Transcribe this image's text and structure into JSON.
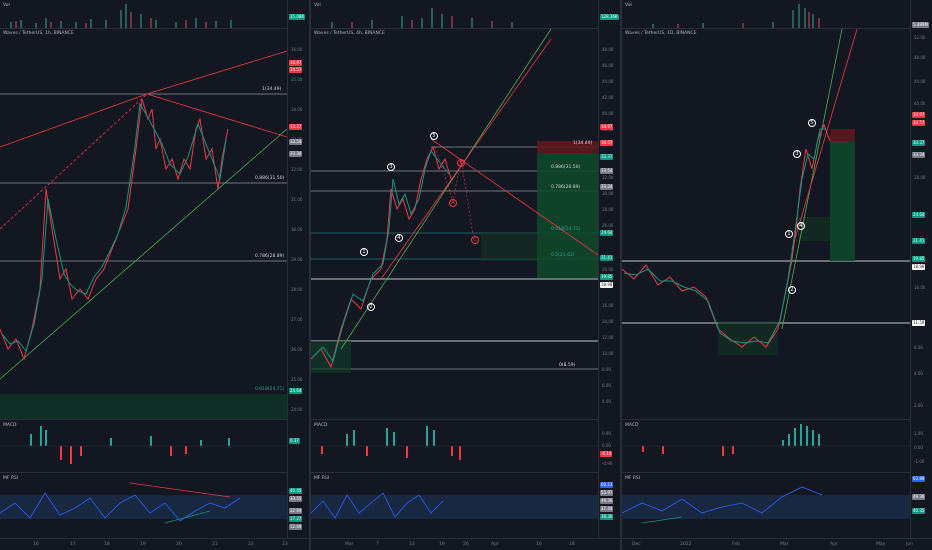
{
  "panels": [
    {
      "vol_label": "Vol",
      "vol_tag": "25.08K",
      "title": "Waves / TetherUS, 1h, BINANCE",
      "macd_label": "MACD",
      "rsi_label": "MF RSI",
      "price_ticks": [
        "36.00",
        "35.00",
        "34.00",
        "33.00",
        "32.00",
        "31.00",
        "30.00",
        "29.00",
        "28.00",
        "27.00",
        "26.00",
        "25.00",
        "24.00"
      ],
      "tags": [
        {
          "t": "34.97",
          "c": "#f23645"
        },
        {
          "t": "34.57",
          "c": "#f23645"
        },
        {
          "t": "33.37",
          "c": "#f23645"
        },
        {
          "t": "33.54",
          "c": "#787b86"
        },
        {
          "t": "33.34",
          "c": "#787b86"
        },
        {
          "t": "24.64",
          "c": "#089981"
        }
      ],
      "fibs": [
        "1(34.49)",
        "0.886(31.50)",
        "0.786(28.89)",
        "0.618(24.71)"
      ],
      "macd_tag": "0.37",
      "rsi_tags": [
        "40.45",
        "33.55",
        "22.84",
        "17.27",
        "12.69"
      ],
      "time_labels": [
        "16",
        "17",
        "18",
        "19",
        "20",
        "21",
        "22",
        "23"
      ]
    },
    {
      "vol_label": "Vol",
      "vol_tag": "128.36K",
      "title": "Waves / TetherUS, 4h, BINANCE",
      "macd_label": "MACD",
      "rsi_label": "MF RSI",
      "price_ticks": [
        "48.00",
        "46.00",
        "44.00",
        "42.00",
        "40.00",
        "38.00",
        "36.00",
        "34.00",
        "32.00",
        "30.00",
        "28.00",
        "26.00",
        "24.00",
        "22.00",
        "20.00",
        "18.00",
        "16.00",
        "14.00",
        "12.00",
        "10.00",
        "8.00",
        "6.00",
        "4.00"
      ],
      "tags": [
        {
          "t": "34.97",
          "c": "#f23645"
        },
        {
          "t": "34.57",
          "c": "#f23645"
        },
        {
          "t": "33.37",
          "c": "#089981"
        },
        {
          "t": "33.54",
          "c": "#787b86"
        },
        {
          "t": "33.34",
          "c": "#787b86"
        },
        {
          "t": "24.64",
          "c": "#089981"
        },
        {
          "t": "21.41",
          "c": "#089981"
        },
        {
          "t": "19.85",
          "c": "#089981"
        },
        {
          "t": "18.98",
          "c": "#ffffff"
        }
      ],
      "fibs": [
        "1(34.49)",
        "0.886(31.50)",
        "0.786(28.89)",
        "0.618(24.71)",
        "0.5(21.62)",
        "0(8.59)"
      ],
      "waves": [
        "1",
        "2",
        "3",
        "4",
        "5",
        "A",
        "B",
        "C"
      ],
      "macd_ticks": [
        "0.90",
        "0.00",
        "-0.90"
      ],
      "macd_tag": "-0.14",
      "rsi_tags": [
        "60.23",
        "55.97",
        "49.36",
        "37.44",
        "28.30"
      ],
      "time_labels": [
        "Mar",
        "7",
        "13",
        "19",
        "26",
        "Apr",
        "10",
        "18"
      ]
    },
    {
      "vol_label": "Vol",
      "vol_tag": "5.489M",
      "title": "Waves / TetherUS, 1D, BINANCE",
      "macd_label": "MACD",
      "rsi_label": "MF RSI",
      "price_ticks": [
        "52.00",
        "48.00",
        "44.00",
        "40.00",
        "36.00",
        "32.00",
        "28.00",
        "24.00",
        "20.00",
        "16.00",
        "12.00",
        "8.00",
        "4.00",
        "2.00"
      ],
      "tags": [
        {
          "t": "34.97",
          "c": "#f23645"
        },
        {
          "t": "34.57",
          "c": "#f23645"
        },
        {
          "t": "33.37",
          "c": "#089981"
        },
        {
          "t": "33.34",
          "c": "#787b86"
        },
        {
          "t": "24.64",
          "c": "#089981"
        },
        {
          "t": "21.41",
          "c": "#089981"
        },
        {
          "t": "19.85",
          "c": "#089981"
        },
        {
          "t": "18.98",
          "c": "#ffffff"
        },
        {
          "t": "11.59",
          "c": "#ffffff"
        }
      ],
      "waves": [
        "1",
        "2",
        "3",
        "4",
        "5"
      ],
      "macd_ticks": [
        "1.00",
        "0.00",
        "-1.00"
      ],
      "rsi_tags": [
        "63.89",
        "49.36",
        "40.35"
      ],
      "time_labels": [
        "Dec",
        "2022",
        "Feb",
        "Mar",
        "Apr",
        "May",
        "Jun"
      ]
    }
  ]
}
